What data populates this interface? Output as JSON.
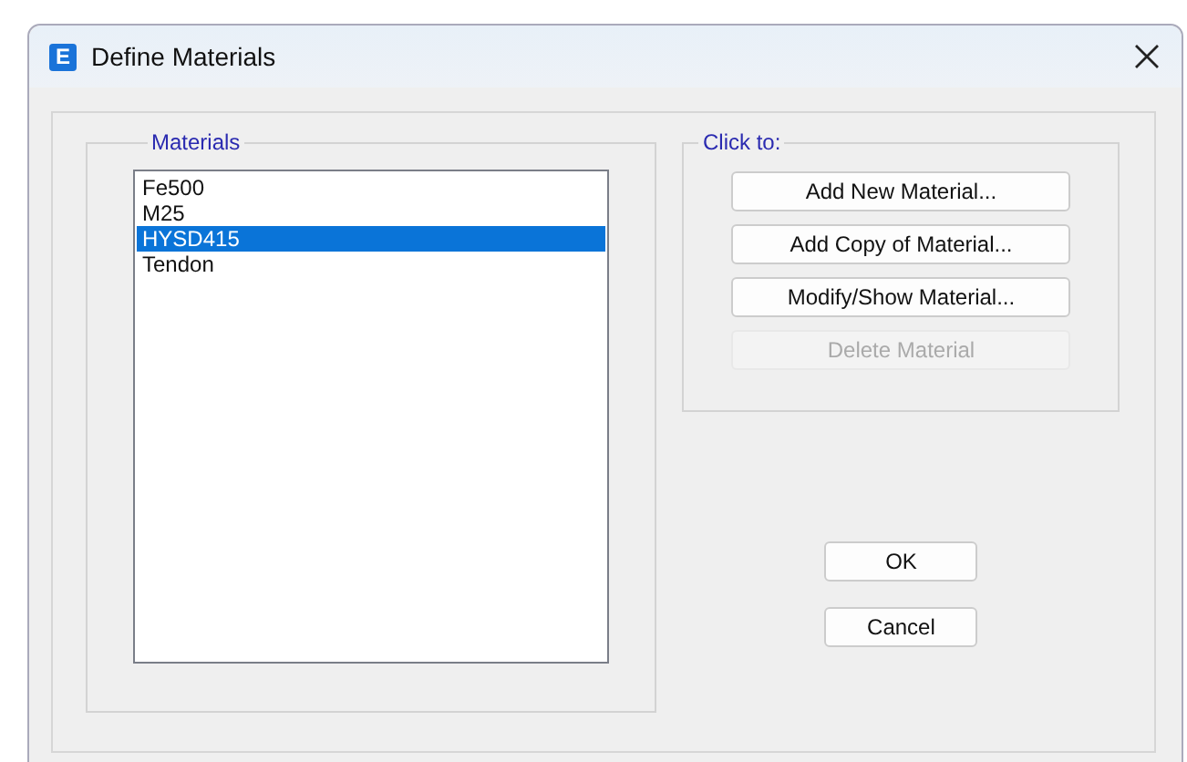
{
  "window": {
    "title": "Define Materials",
    "app_icon": "E"
  },
  "materials": {
    "label": "Materials",
    "items": [
      {
        "name": "Fe500",
        "selected": false
      },
      {
        "name": "M25",
        "selected": false
      },
      {
        "name": "HYSD415",
        "selected": true
      },
      {
        "name": "Tendon",
        "selected": false
      }
    ]
  },
  "actions": {
    "label": "Click to:",
    "buttons": [
      {
        "label": "Add New Material...",
        "disabled": false
      },
      {
        "label": "Add Copy of Material...",
        "disabled": false
      },
      {
        "label": "Modify/Show Material...",
        "disabled": false
      },
      {
        "label": "Delete Material",
        "disabled": true
      }
    ]
  },
  "buttons": [
    "OK",
    "Cancel"
  ]
}
